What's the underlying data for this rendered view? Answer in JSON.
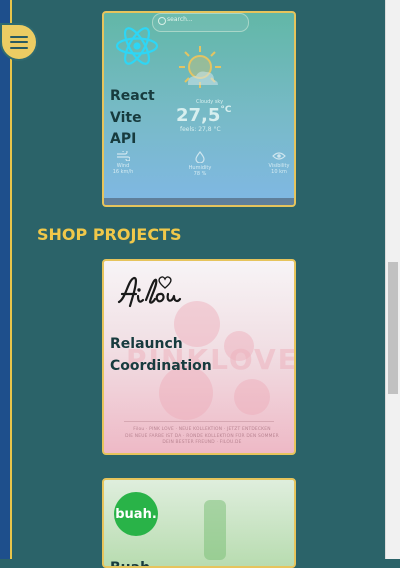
{
  "nav": {
    "menu_icon": "hamburger-menu-icon"
  },
  "projects": [
    {
      "labels": [
        "React",
        "Vite",
        "API"
      ],
      "logo_icon": "react-logo-icon",
      "preview": {
        "search_placeholder": "search...",
        "temperature": "27,5",
        "temperature_unit": "°C",
        "description": "Cloudy sky",
        "feels_like": "feels: 27,8 °C",
        "stats": [
          {
            "icon": "wind-icon",
            "label": "Wind",
            "value": "16 km/h"
          },
          {
            "icon": "humidity-icon",
            "label": "Humidity",
            "value": "78 %"
          },
          {
            "icon": "visibility-icon",
            "label": "Visibility",
            "value": "10 km"
          }
        ]
      }
    }
  ],
  "sections": [
    {
      "title": "SHOP PROJECTS",
      "projects": [
        {
          "labels": [
            "Relaunch",
            "Coordination"
          ],
          "logo_text": "filou",
          "preview": {
            "hero_text": "PINKLOVE",
            "fine_print": [
              "Filou · PINK LOVE · NEUE KOLLEKTION · JETZT ENTDECKEN",
              "DIE NEUE FARBE IST DA · RONDE KOLLEKTION FÜR DEN SOMMER",
              "DEIN BESTER FREUND · FILOU.DE"
            ]
          }
        },
        {
          "labels": [
            "Buah"
          ],
          "logo_text": "buah."
        }
      ]
    }
  ],
  "colors": {
    "background": "#2b6369",
    "accent": "#f0c84a",
    "card_border": "#e6c45c",
    "rail": "#1e4f8c"
  }
}
